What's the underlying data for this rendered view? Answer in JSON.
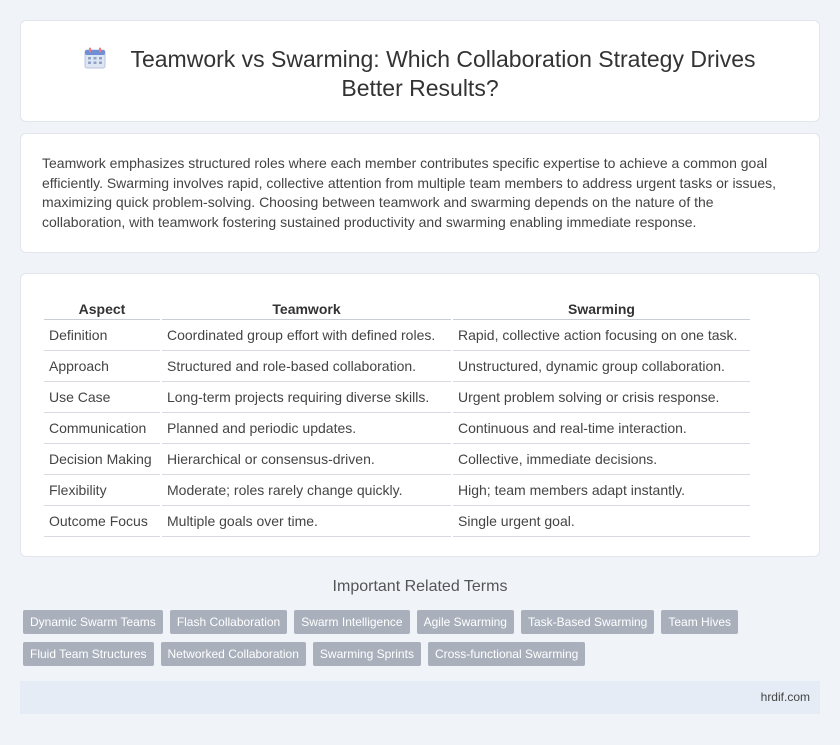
{
  "header": {
    "title": "Teamwork vs Swarming: Which Collaboration Strategy Drives Better Results?",
    "icon": "calendar-icon"
  },
  "intro": {
    "text": "Teamwork emphasizes structured roles where each member contributes specific expertise to achieve a common goal efficiently. Swarming involves rapid, collective attention from multiple team members to address urgent tasks or issues, maximizing quick problem-solving. Choosing between teamwork and swarming depends on the nature of the collaboration, with teamwork fostering sustained productivity and swarming enabling immediate response."
  },
  "table": {
    "headers": [
      "Aspect",
      "Teamwork",
      "Swarming"
    ],
    "rows": [
      [
        "Definition",
        "Coordinated group effort with defined roles.",
        "Rapid, collective action focusing on one task."
      ],
      [
        "Approach",
        "Structured and role-based collaboration.",
        "Unstructured, dynamic group collaboration."
      ],
      [
        "Use Case",
        "Long-term projects requiring diverse skills.",
        "Urgent problem solving or crisis response."
      ],
      [
        "Communication",
        "Planned and periodic updates.",
        "Continuous and real-time interaction."
      ],
      [
        "Decision Making",
        "Hierarchical or consensus-driven.",
        "Collective, immediate decisions."
      ],
      [
        "Flexibility",
        "Moderate; roles rarely change quickly.",
        "High; team members adapt instantly."
      ],
      [
        "Outcome Focus",
        "Multiple goals over time.",
        "Single urgent goal."
      ]
    ]
  },
  "related": {
    "heading": "Important Related Terms",
    "tags": [
      "Dynamic Swarm Teams",
      "Flash Collaboration",
      "Swarm Intelligence",
      "Agile Swarming",
      "Task-Based Swarming",
      "Team Hives",
      "Fluid Team Structures",
      "Networked Collaboration",
      "Swarming Sprints",
      "Cross-functional Swarming"
    ]
  },
  "footer": {
    "site": "hrdif.com"
  },
  "colors": {
    "background": "#f0f3f8",
    "tag": "#a9b0bc",
    "footer": "#e6ecf5"
  }
}
